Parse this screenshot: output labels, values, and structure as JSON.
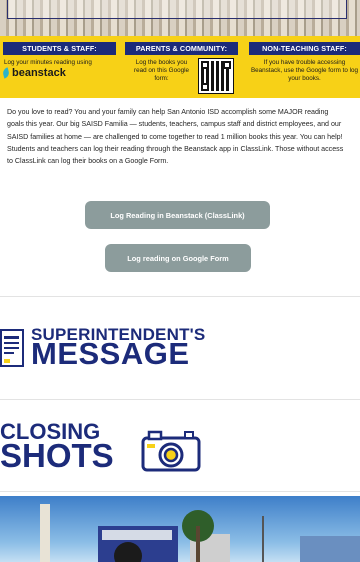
{
  "banner": {
    "students": {
      "heading": "STUDENTS & STAFF:",
      "text": "Log your minutes reading using",
      "logo_word": "beanstack"
    },
    "parents": {
      "heading": "PARENTS & COMMUNITY:",
      "text": "Log the books you read on this Google form:"
    },
    "nonteaching": {
      "heading": "NON-TEACHING STAFF:",
      "text": "If you have trouble accessing Beanstack, use the Google form to log your books."
    },
    "accent": "#f7d117",
    "navy": "#1c2b7a"
  },
  "intro": {
    "text": "Do you love to read? You and your family can help San Antonio ISD accomplish some MAJOR reading goals this year. Our big SAISD Familia — students, teachers, campus staff and district employees, and our SAISD families at home — are challenged to come together to read 1 million books this year. You can help! Students and teachers can log their reading through the Beanstack app in ClassLink. Those without access to ClassLink can log their books on a Google Form."
  },
  "buttons": {
    "beanstack": "Log Reading in Beanstack (ClassLink)",
    "google_form": "Log reading on Google Form",
    "color": "#8c9c9c"
  },
  "sections": {
    "superintendent": {
      "line1": "SUPERINTENDENT'S",
      "line2": "MESSAGE",
      "icon": "document-icon"
    },
    "closing": {
      "line1": "CLOSING",
      "line2": "SHOTS",
      "icon": "camera-icon"
    }
  }
}
